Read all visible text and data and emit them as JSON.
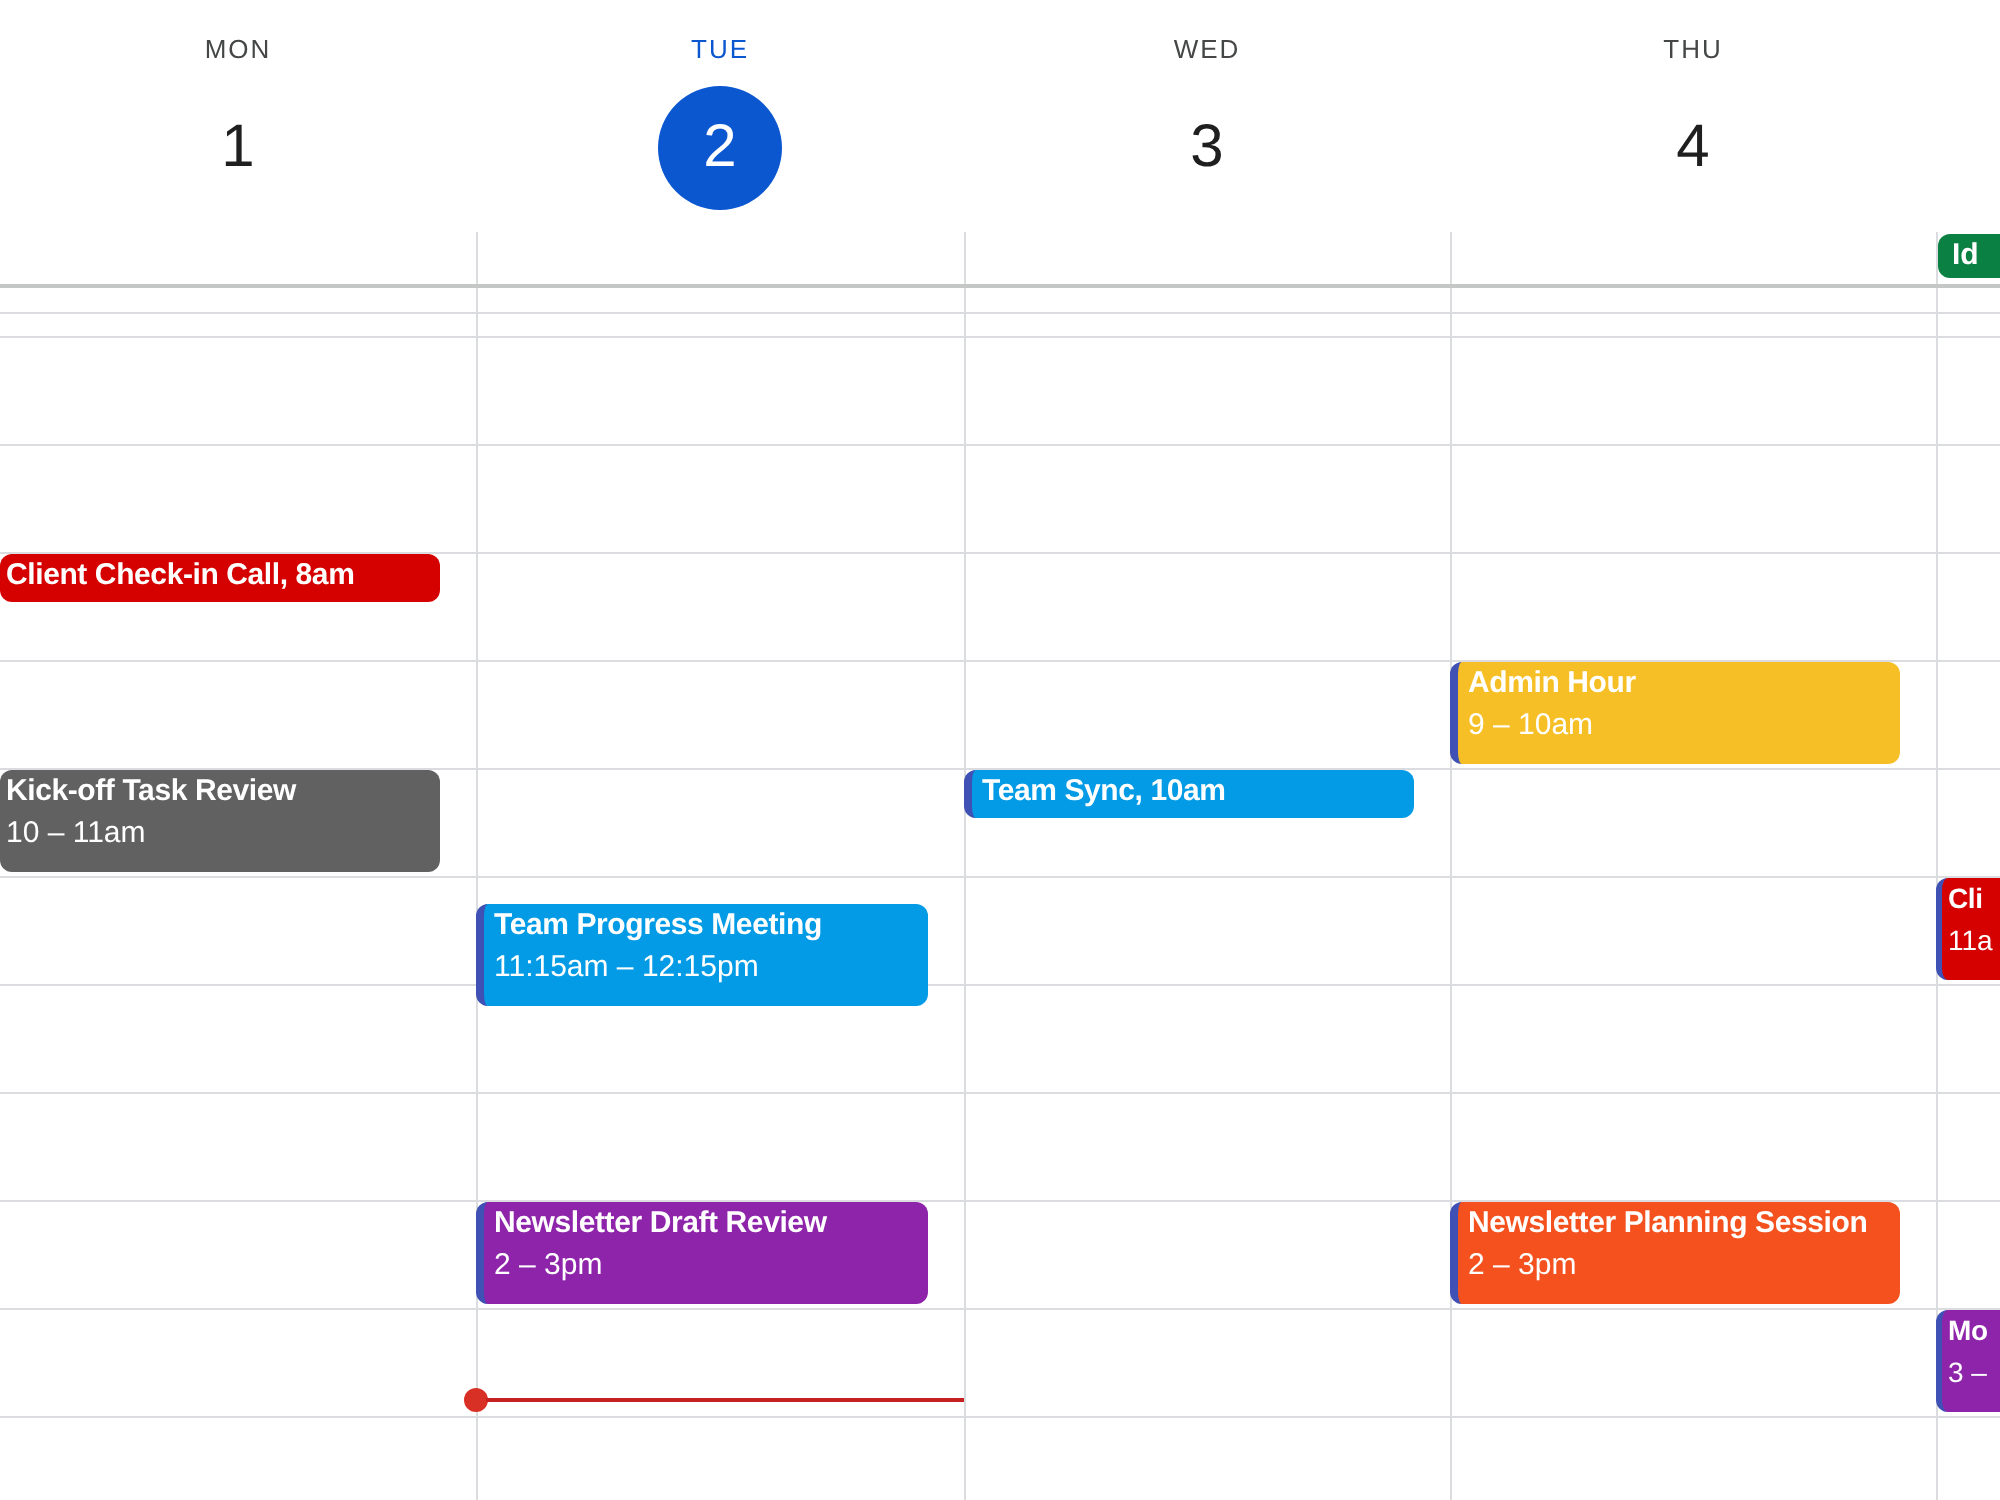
{
  "days": [
    {
      "name": "MON",
      "date": "1",
      "selected": false,
      "events": [
        {
          "title": "Client Check-in Call, 8am",
          "color": "#d50000"
        },
        {
          "title": "Kick-off Task Review",
          "time": "10 – 11am",
          "color": "#616161"
        }
      ]
    },
    {
      "name": "TUE",
      "date": "2",
      "selected": true,
      "events": [
        {
          "title": "Team Progress Meeting",
          "time": "11:15am – 12:15pm",
          "color": "#039be5"
        },
        {
          "title": "Newsletter Draft Review",
          "time": "2 – 3pm",
          "color": "#8e24aa"
        }
      ]
    },
    {
      "name": "WED",
      "date": "3",
      "selected": false,
      "events": [
        {
          "title": "Team Sync, 10am",
          "color": "#039be5"
        }
      ]
    },
    {
      "name": "THU",
      "date": "4",
      "selected": false,
      "events": [
        {
          "title": "Admin Hour",
          "time": "9 – 10am",
          "color": "#f6bf26"
        },
        {
          "title": "Newsletter Planning Session",
          "time": "2 – 3pm",
          "color": "#f4511e"
        }
      ]
    },
    {
      "all_day": [
        {
          "title": "Id",
          "color": "#0b8043"
        }
      ],
      "events": [
        {
          "title": "Cli",
          "time": "11a",
          "color": "#d50000"
        },
        {
          "title": "Mo",
          "time": "3 –",
          "color": "#8e24aa"
        }
      ]
    }
  ]
}
